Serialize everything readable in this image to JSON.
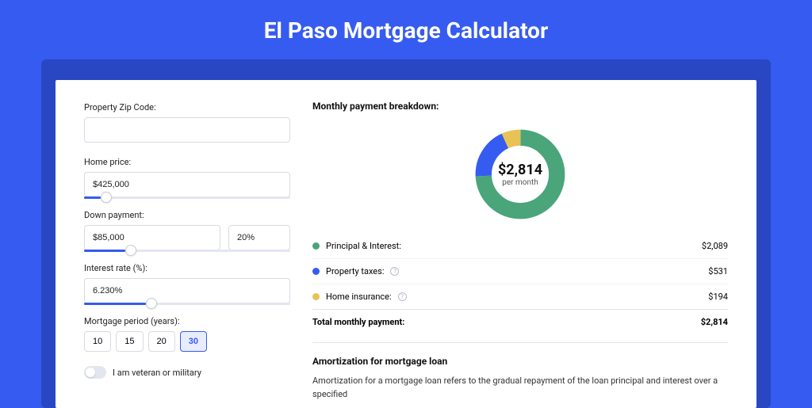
{
  "title": "El Paso Mortgage Calculator",
  "left": {
    "zip_label": "Property Zip Code:",
    "zip_value": "",
    "price_label": "Home price:",
    "price_value": "$425,000",
    "price_slider_pct": 8,
    "down_label": "Down payment:",
    "down_amount": "$85,000",
    "down_pct_value": "20%",
    "down_slider_pct": 20,
    "rate_label": "Interest rate (%):",
    "rate_value": "6.230%",
    "rate_slider_pct": 30,
    "period_label": "Mortgage period (years):",
    "periods": [
      "10",
      "15",
      "20",
      "30"
    ],
    "period_selected": "30",
    "veteran_label": "I am veteran or military"
  },
  "right": {
    "breakdown_heading": "Monthly payment breakdown:",
    "total_amount": "$2,814",
    "total_sub": "per month",
    "items": [
      {
        "label": "Principal & Interest:",
        "value": "$2,089",
        "color": "green",
        "info": false
      },
      {
        "label": "Property taxes:",
        "value": "$531",
        "color": "blue",
        "info": true
      },
      {
        "label": "Home insurance:",
        "value": "$194",
        "color": "yellow",
        "info": true
      }
    ],
    "total_row_label": "Total monthly payment:",
    "total_row_value": "$2,814",
    "amort_heading": "Amortization for mortgage loan",
    "amort_text": "Amortization for a mortgage loan refers to the gradual repayment of the loan principal and interest over a specified"
  },
  "chart_data": {
    "type": "pie",
    "title": "Monthly payment breakdown",
    "center_label": "$2,814 per month",
    "series": [
      {
        "name": "Principal & Interest",
        "value": 2089,
        "color": "#4aa57a"
      },
      {
        "name": "Property taxes",
        "value": 531,
        "color": "#365bf0"
      },
      {
        "name": "Home insurance",
        "value": 194,
        "color": "#e9c256"
      }
    ],
    "total": 2814
  }
}
